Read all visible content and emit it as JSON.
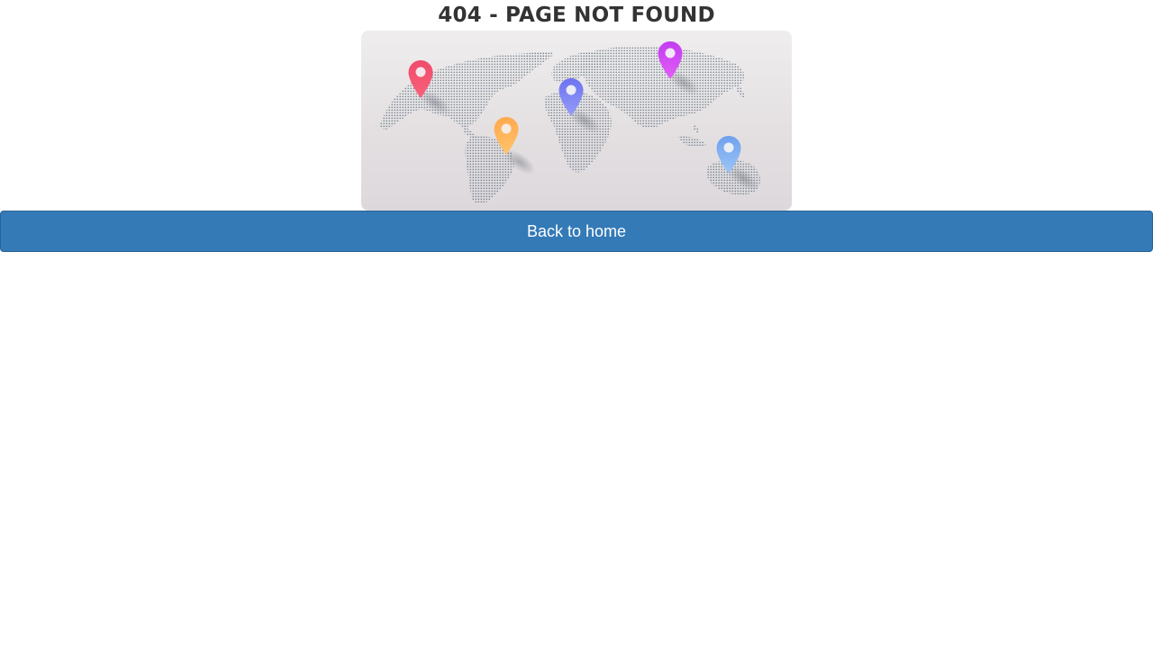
{
  "page": {
    "title": "404 - PAGE NOT FOUND"
  },
  "illustration": {
    "name": "world-map-with-location-pins",
    "pins": [
      {
        "name": "pin-red-icon",
        "color": "#f0506e"
      },
      {
        "name": "pin-orange-icon",
        "color": "#ffb74d"
      },
      {
        "name": "pin-indigo-icon",
        "color": "#7f86f4"
      },
      {
        "name": "pin-magenta-icon",
        "color": "#d946ef"
      },
      {
        "name": "pin-blue-icon",
        "color": "#7fb0f2"
      }
    ],
    "dot_color": "#5d6f7c"
  },
  "actions": {
    "back_home_label": "Back to home",
    "button_color": "#337ab7"
  }
}
